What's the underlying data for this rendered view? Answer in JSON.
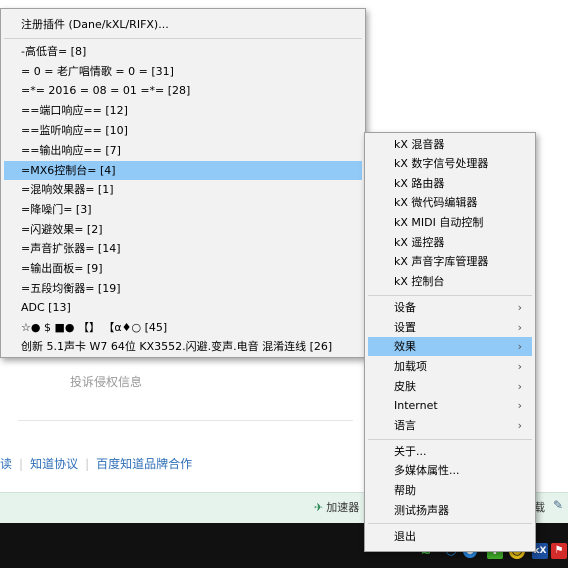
{
  "background": {
    "complaint_link": "投诉侵权信息",
    "footer_links": [
      "读",
      "知道协议",
      "百度知道品牌合作"
    ],
    "footer_separator": "|",
    "status_accelerator": "加速器",
    "status_right": "载"
  },
  "left_menu": {
    "items": [
      {
        "label": "注册插件 (Dane/kXL/RIFX)..."
      },
      {
        "label": "-高低音= [8]"
      },
      {
        "label": "= 0 = 老广唱情歌 = 0 = [31]"
      },
      {
        "label": "=*=   2016 = 08 =  01 =*= [28]"
      },
      {
        "label": "==端口响应== [12]"
      },
      {
        "label": "==监听响应== [10]"
      },
      {
        "label": "==输出响应== [7]"
      },
      {
        "label": "=MX6控制台= [4]"
      },
      {
        "label": "=混响效果器= [1]"
      },
      {
        "label": "=降噪门= [3]"
      },
      {
        "label": "=闪避效果= [2]"
      },
      {
        "label": "=声音扩张器= [14]"
      },
      {
        "label": "=输出面板= [9]"
      },
      {
        "label": "=五段均衡器= [19]"
      },
      {
        "label": "ADC [13]"
      },
      {
        "label": "☆● $ ■● 【】 【α♦○ [45]"
      },
      {
        "label": "创新 5.1声卡 W7 64位 KX3552.闪避.变声.电音 混淆连线 [26]"
      }
    ]
  },
  "right_menu": {
    "chevron": "›",
    "items": [
      {
        "label": "kX 混音器"
      },
      {
        "label": "kX 数字信号处理器"
      },
      {
        "label": "kX 路由器"
      },
      {
        "label": "kX 微代码编辑器"
      },
      {
        "label": "kX MIDI 自动控制"
      },
      {
        "label": "kX 遥控器"
      },
      {
        "label": "kX 声音字库管理器"
      },
      {
        "label": "kX 控制台"
      },
      {
        "label": "设备"
      },
      {
        "label": "设置"
      },
      {
        "label": "效果"
      },
      {
        "label": "加载项"
      },
      {
        "label": "皮肤"
      },
      {
        "label": "Internet"
      },
      {
        "label": "语言"
      },
      {
        "label": "关于..."
      },
      {
        "label": "多媒体属性..."
      },
      {
        "label": "帮助"
      },
      {
        "label": "测试扬声器"
      },
      {
        "label": "退出"
      }
    ]
  },
  "taskbar": {
    "tray_icons": [
      "wifi-icon",
      "qq-penguin-icon",
      "blue-orb-icon",
      "shield-icon",
      "chat-icon",
      "kx-tray-icon",
      "flag-icon"
    ]
  },
  "colors": {
    "menu_bg": "#f2f2f2",
    "highlight": "#91c9f7",
    "taskbar": "#111111",
    "status_bar": "#e6f3ec",
    "link": "#2f6fb8"
  }
}
